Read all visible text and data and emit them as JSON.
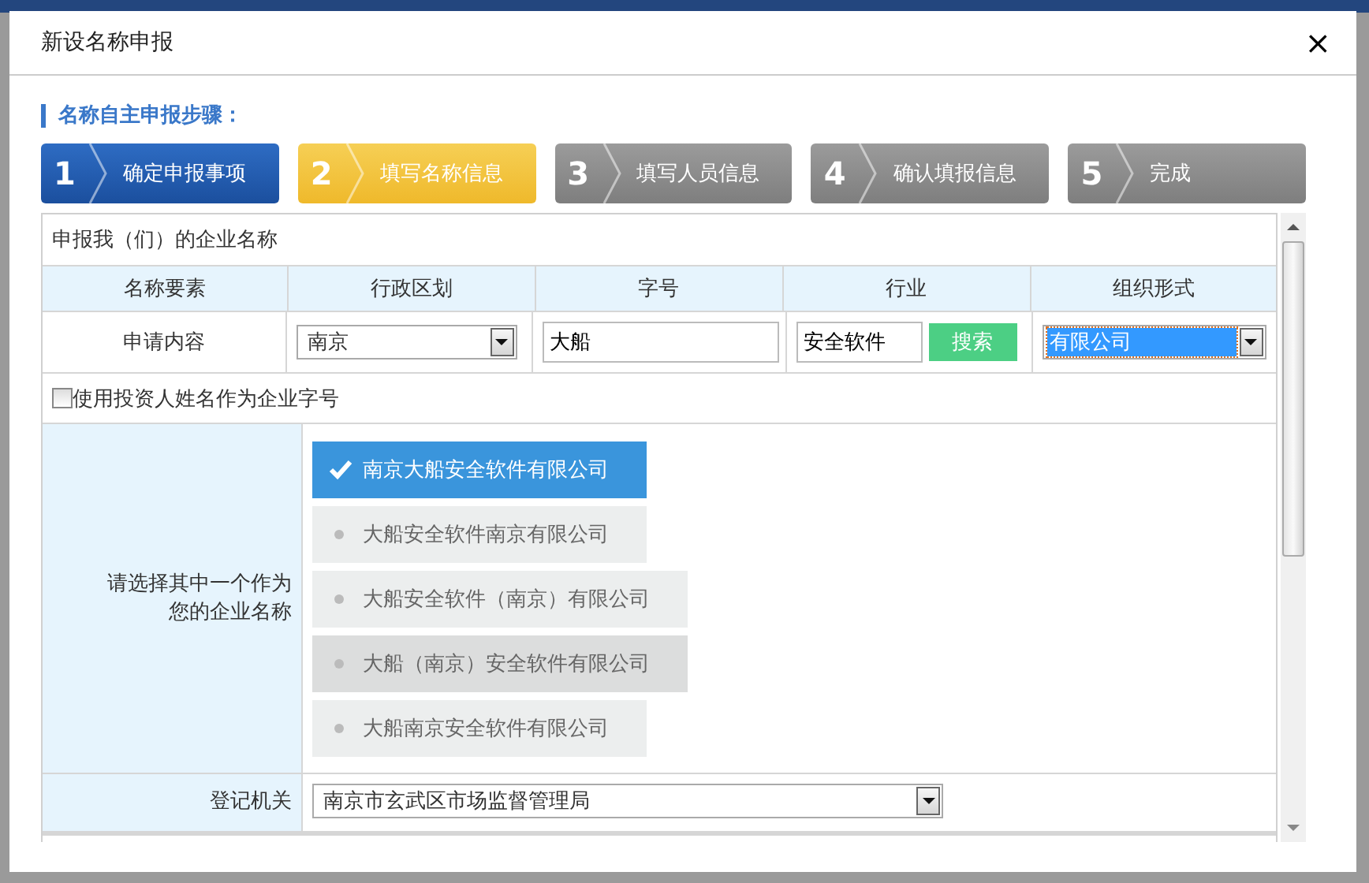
{
  "dialog": {
    "title": "新设名称申报",
    "close": "×"
  },
  "steps_title": "名称自主申报步骤：",
  "steps": [
    {
      "number": "1",
      "label": "确定申报事项",
      "completed": true,
      "selected": false
    },
    {
      "number": "2",
      "label": "填写名称信息",
      "completed": false,
      "selected": true
    },
    {
      "number": "3",
      "label": "填写人员信息",
      "completed": false,
      "selected": false
    },
    {
      "number": "4",
      "label": "确认填报信息",
      "completed": false,
      "selected": false
    },
    {
      "number": "5",
      "label": "完成",
      "completed": false,
      "selected": false
    }
  ],
  "form": {
    "section_title": "申报我（们）的企业名称",
    "columns": [
      "名称要素",
      "行政区划",
      "字号",
      "行业",
      "组织形式"
    ],
    "row_label": "申请内容",
    "region": {
      "value": "南京"
    },
    "trade_name": {
      "value": "大船"
    },
    "industry": {
      "value": "安全软件"
    },
    "search_button": "搜索",
    "org_form": {
      "value": "有限公司",
      "focused": true
    },
    "use_investor_name": {
      "label": "使用投资人姓名作为企业字号",
      "checked": false
    },
    "choose_label": "请选择其中一个作为您的企业名称",
    "name_options": [
      {
        "label": "南京大船安全软件有限公司",
        "selected": true,
        "hovered": false
      },
      {
        "label": "大船安全软件南京有限公司",
        "selected": false,
        "hovered": false
      },
      {
        "label": "大船安全软件（南京）有限公司",
        "selected": false,
        "hovered": false
      },
      {
        "label": "大船（南京）安全软件有限公司",
        "selected": false,
        "hovered": true
      },
      {
        "label": "大船南京安全软件有限公司",
        "selected": false,
        "hovered": false
      }
    ],
    "authority_label": "登记机关",
    "authority": {
      "value": "南京市玄武区市场监督管理局"
    }
  }
}
